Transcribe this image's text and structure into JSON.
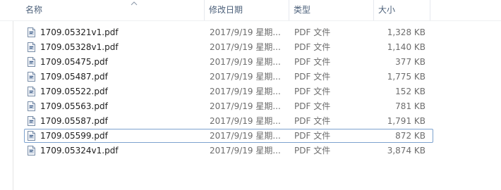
{
  "columns": {
    "name": "名称",
    "modified": "修改日期",
    "type": "类型",
    "size": "大小"
  },
  "files": [
    {
      "name": "1709.05321v1.pdf",
      "modified": "2017/9/19 星期...",
      "type": "PDF 文件",
      "size": "1,328 KB",
      "selected": false
    },
    {
      "name": "1709.05328v1.pdf",
      "modified": "2017/9/19 星期...",
      "type": "PDF 文件",
      "size": "1,140 KB",
      "selected": false
    },
    {
      "name": "1709.05475.pdf",
      "modified": "2017/9/19 星期...",
      "type": "PDF 文件",
      "size": "377 KB",
      "selected": false
    },
    {
      "name": "1709.05487.pdf",
      "modified": "2017/9/19 星期...",
      "type": "PDF 文件",
      "size": "1,775 KB",
      "selected": false
    },
    {
      "name": "1709.05522.pdf",
      "modified": "2017/9/19 星期...",
      "type": "PDF 文件",
      "size": "152 KB",
      "selected": false
    },
    {
      "name": "1709.05563.pdf",
      "modified": "2017/9/19 星期...",
      "type": "PDF 文件",
      "size": "781 KB",
      "selected": false
    },
    {
      "name": "1709.05587.pdf",
      "modified": "2017/9/19 星期...",
      "type": "PDF 文件",
      "size": "1,791 KB",
      "selected": false
    },
    {
      "name": "1709.05599.pdf",
      "modified": "2017/9/19 星期...",
      "type": "PDF 文件",
      "size": "872 KB",
      "selected": true
    },
    {
      "name": "1709.05324v1.pdf",
      "modified": "2017/9/19 星期...",
      "type": "PDF 文件",
      "size": "3,874 KB",
      "selected": false
    }
  ],
  "icons": {
    "file": "pdf-file-icon",
    "sort": "sort-ascending-icon"
  }
}
